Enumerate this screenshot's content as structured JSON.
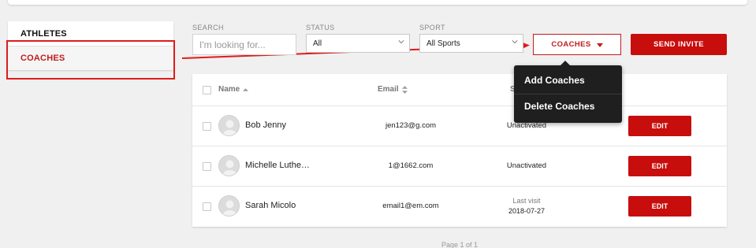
{
  "sidebar": {
    "items": [
      {
        "label": "ATHLETES"
      },
      {
        "label": "COACHES"
      }
    ]
  },
  "filters": {
    "search_label": "SEARCH",
    "search_placeholder": "I'm looking for...",
    "status_label": "STATUS",
    "status_value": "All",
    "sport_label": "SPORT",
    "sport_value": "All Sports"
  },
  "actions": {
    "coaches_label": "COACHES",
    "send_invite_label": "SEND INVITE"
  },
  "menu": {
    "items": [
      "Add Coaches",
      "Delete Coaches"
    ]
  },
  "table": {
    "columns": {
      "name": "Name",
      "email": "Email",
      "status": "S"
    },
    "rows": [
      {
        "name": "Bob Jenny",
        "email": "jen123@g.com",
        "status": "Unactivated",
        "edit": "EDIT"
      },
      {
        "name": "Michelle Luthe…",
        "email": "1@1662.com",
        "status": "Unactivated",
        "edit": "EDIT"
      },
      {
        "name": "Sarah Micolo",
        "email": "email1@em.com",
        "status_label": "Last visit",
        "status_date": "2018-07-27",
        "edit": "EDIT"
      }
    ]
  },
  "pagination": {
    "text": "Page 1 of 1"
  },
  "colors": {
    "accent": "#c80d0d",
    "annotation": "#e01b1b",
    "menu_bg": "#1f1f1f"
  }
}
